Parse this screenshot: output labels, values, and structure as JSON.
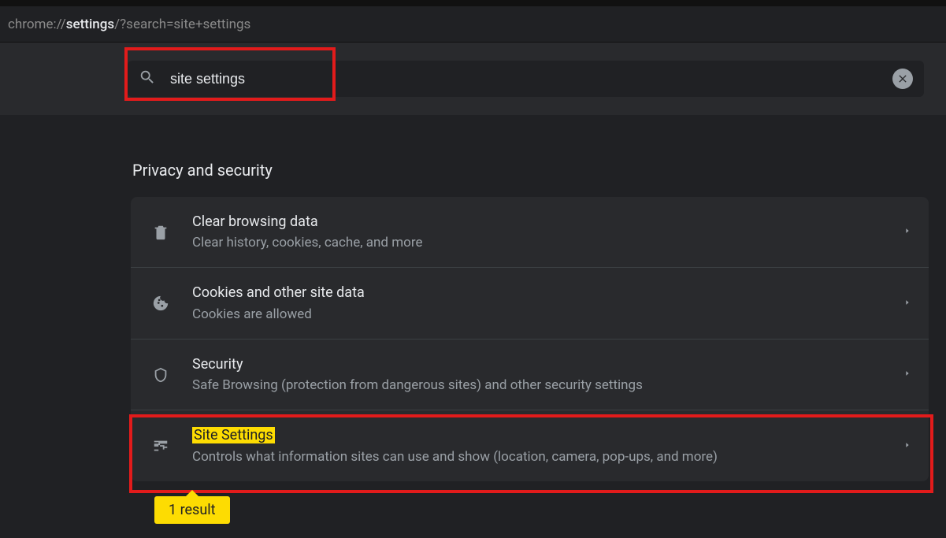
{
  "url": {
    "prefix": "chrome://",
    "bold": "settings",
    "suffix": "/?search=site+settings"
  },
  "search": {
    "value": "site settings"
  },
  "section": {
    "title": "Privacy and security",
    "rows": [
      {
        "title": "Clear browsing data",
        "sub": "Clear history, cookies, cache, and more"
      },
      {
        "title": "Cookies and other site data",
        "sub": "Cookies are allowed"
      },
      {
        "title": "Security",
        "sub": "Safe Browsing (protection from dangerous sites) and other security settings"
      },
      {
        "title": "Site Settings",
        "sub": "Controls what information sites can use and show (location, camera, pop-ups, and more)"
      }
    ]
  },
  "badge": "1 result"
}
